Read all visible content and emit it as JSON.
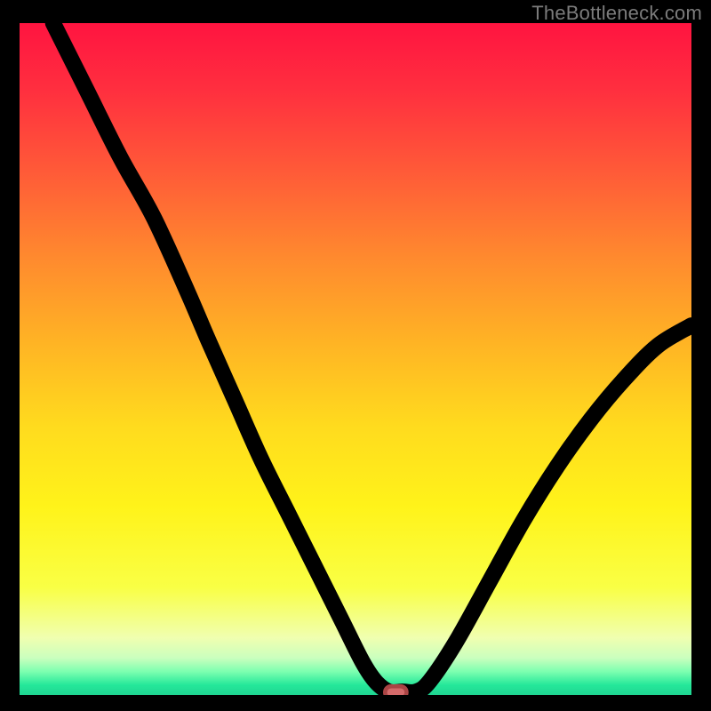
{
  "watermark": "TheBottleneck.com",
  "colors": {
    "gradient_stops": [
      {
        "offset": 0.0,
        "hex": "#ff1440"
      },
      {
        "offset": 0.1,
        "hex": "#ff2f3f"
      },
      {
        "offset": 0.22,
        "hex": "#ff5a38"
      },
      {
        "offset": 0.35,
        "hex": "#ff8a2e"
      },
      {
        "offset": 0.48,
        "hex": "#ffb524"
      },
      {
        "offset": 0.6,
        "hex": "#ffdb1e"
      },
      {
        "offset": 0.72,
        "hex": "#fff31a"
      },
      {
        "offset": 0.84,
        "hex": "#f9ff45"
      },
      {
        "offset": 0.915,
        "hex": "#f0ffb0"
      },
      {
        "offset": 0.945,
        "hex": "#caffbe"
      },
      {
        "offset": 0.965,
        "hex": "#7dffb0"
      },
      {
        "offset": 0.985,
        "hex": "#25e89a"
      },
      {
        "offset": 1.0,
        "hex": "#1fd592"
      }
    ],
    "curve": "#000000",
    "marker": "#d46a6a",
    "frame": "#000000"
  },
  "chart_data": {
    "type": "line",
    "title": "",
    "xlabel": "",
    "ylabel": "",
    "xlim": [
      0,
      100
    ],
    "ylim": [
      0,
      100
    ],
    "series": [
      {
        "name": "bottleneck-curve",
        "x": [
          5,
          10,
          15,
          20,
          25,
          28,
          32,
          36,
          40,
          44,
          48,
          51,
          53,
          55,
          57,
          59,
          61,
          65,
          70,
          75,
          80,
          85,
          90,
          95,
          100
        ],
        "values": [
          100,
          90,
          80,
          71,
          60,
          53,
          44,
          35,
          27,
          19,
          11,
          5,
          2,
          0.5,
          0.5,
          0.5,
          2,
          8,
          17,
          26,
          34,
          41,
          47,
          52,
          55
        ]
      }
    ],
    "annotations": [
      {
        "name": "optimal-marker",
        "x": 56,
        "y": 0.4
      }
    ]
  }
}
